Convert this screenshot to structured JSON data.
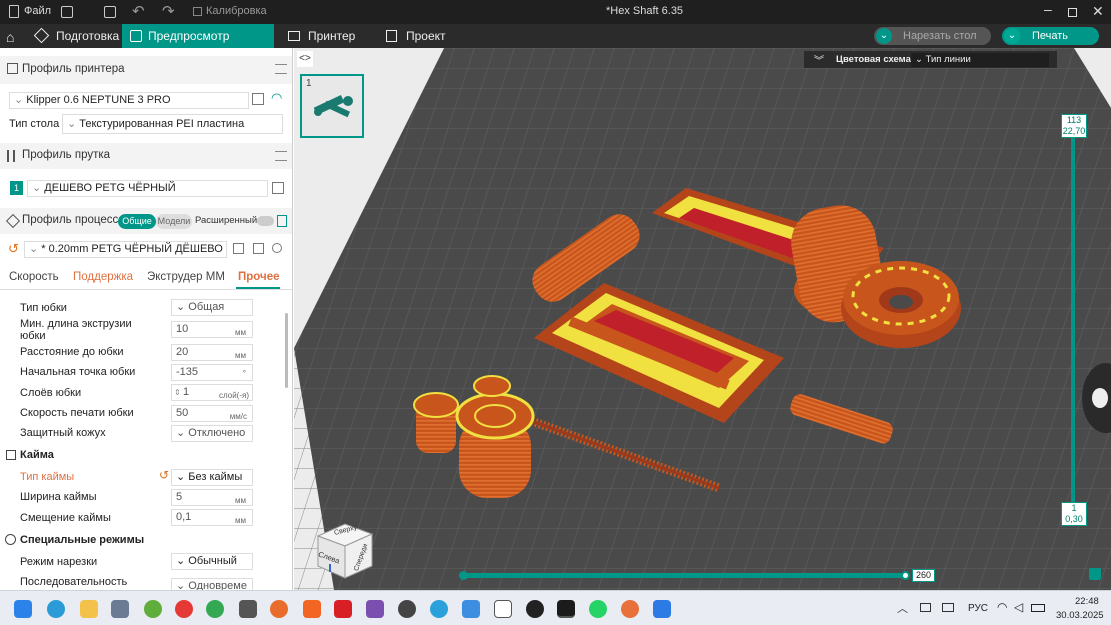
{
  "titlebar": {
    "file": "Файл",
    "calibration": "Калибровка",
    "title": "*Hex Shaft 6.35"
  },
  "tabs": {
    "prepare": "Подготовка",
    "preview": "Предпросмотр нарезки",
    "printer": "Принтер",
    "project": "Проект",
    "slice_plate": "Нарезать стол",
    "print": "Печать"
  },
  "printer_profile": {
    "header": "Профиль принтера",
    "printer": "Klipper 0.6 NEPTUNE 3 PRO",
    "bed_label": "Тип стола",
    "bed_value": "Текстурированная PEI пластина"
  },
  "filament_profile": {
    "header": "Профиль прутка",
    "index": "1",
    "filament": "ДЕШЕВО PETG ЧЁРНЫЙ"
  },
  "process_profile": {
    "header": "Профиль процесса",
    "mode_general": "Общие",
    "mode_models": "Модели",
    "advanced": "Расширенный",
    "preset": "* 0.20mm PETG ЧЁРНЫЙ ДЁШЕВО"
  },
  "subtabs": {
    "speed": "Скорость",
    "support": "Поддержка",
    "multi": "Экструдер MM",
    "other": "Прочее"
  },
  "settings": {
    "skirt_type_label": "Тип юбки",
    "skirt_type_value": "Общая",
    "skirt_min_len_label1": "Мин. длина экструзии",
    "skirt_min_len_label2": "юбки",
    "skirt_min_len_value": "10",
    "mm": "мм",
    "skirt_distance_label": "Расстояние до юбки",
    "skirt_distance_value": "20",
    "skirt_start_label": "Начальная точка юбки",
    "skirt_start_value": "-135",
    "deg": "°",
    "skirt_layers_label": "Слоёв юбки",
    "skirt_layers_value": "1",
    "layers_unit": "слой(-я)",
    "skirt_speed_label": "Скорость печати юбки",
    "skirt_speed_value": "50",
    "speed_unit": "мм/с",
    "draft_shield_label": "Защитный кожух",
    "draft_shield_value": "Отключено",
    "brim_header": "Кайма",
    "brim_type_label": "Тип каймы",
    "brim_type_value": "Без каймы",
    "brim_width_label": "Ширина каймы",
    "brim_width_value": "5",
    "brim_offset_label": "Смещение каймы",
    "brim_offset_value": "0,1",
    "special_header": "Специальные режимы",
    "slice_mode_label": "Режим нарезки",
    "slice_mode_value": "Обычный",
    "sequence_label": "Последовательность",
    "sequence_value": "Одновреме"
  },
  "viewer": {
    "plate_number": "1",
    "color_scheme_label": "Цветовая схема",
    "color_scheme_value": "Тип линии",
    "layer_top": "113",
    "height_top": "22,70",
    "layer_bottom": "1",
    "height_bottom": "0,30",
    "move_value": "260",
    "cube_top": "Сверху",
    "cube_left": "Слева",
    "cube_front": "Спереди"
  },
  "taskbar": {
    "lang": "РУС",
    "time": "22:48",
    "date": "30.03.2025"
  },
  "colors": {
    "accent": "#009688",
    "filament": "#c8551c",
    "infill": "#c0202a",
    "highlight": "#f0e040",
    "bed": "#4a4a4a"
  }
}
